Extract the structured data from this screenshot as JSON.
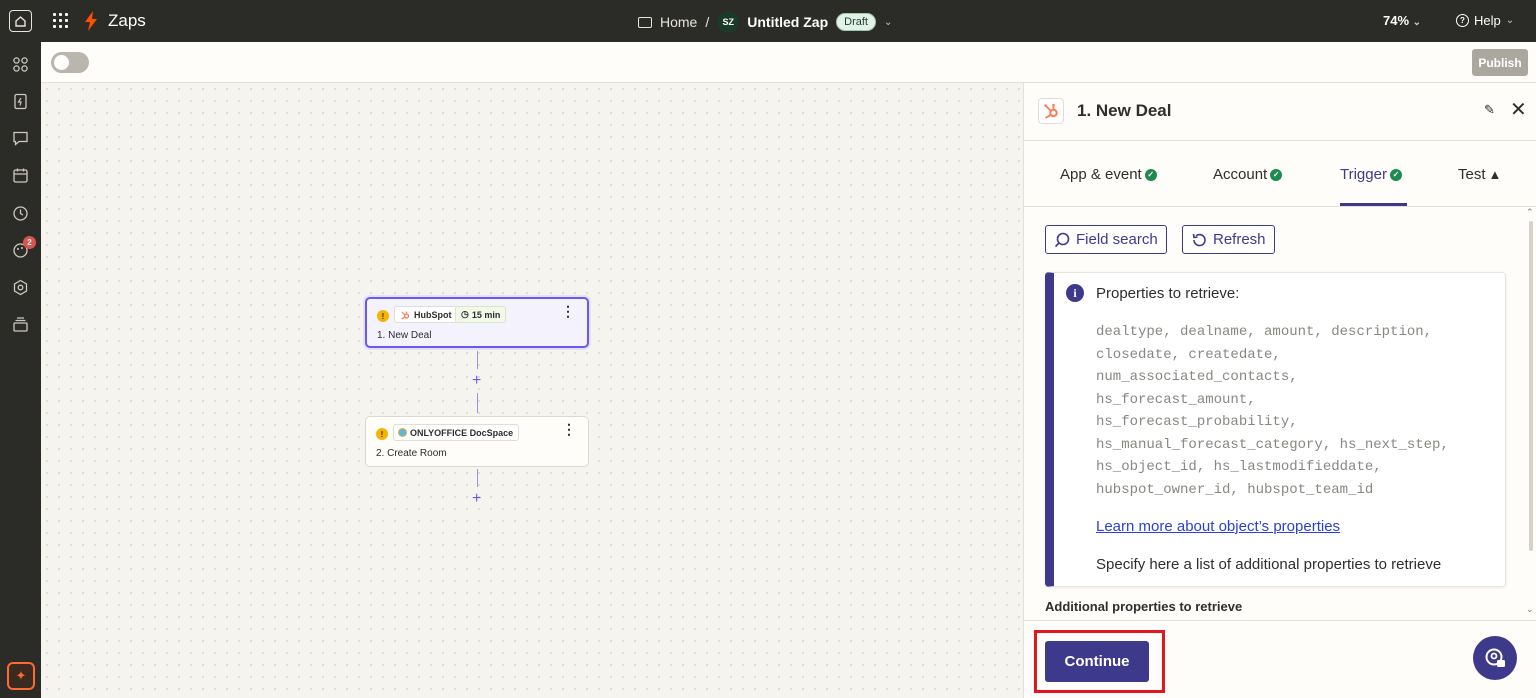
{
  "topbar": {
    "app_name": "Zaps",
    "breadcrumb_home": "Home",
    "breadcrumb_sep": "/",
    "user_initials": "SZ",
    "zap_name": "Untitled Zap",
    "status_badge": "Draft",
    "zoom_level": "74%",
    "help_label": "Help"
  },
  "toolbar": {
    "publish_label": "Publish",
    "zap_enabled": false
  },
  "leftnav": {
    "items": [
      "apps-icon",
      "zaps-icon",
      "interfaces-icon",
      "tables-icon",
      "history-icon",
      "canvas-icon",
      "settings-icon",
      "archive-icon"
    ],
    "notification_count": "2"
  },
  "canvas": {
    "steps": [
      {
        "app": "HubSpot",
        "time": "15 min",
        "title": "1. New Deal"
      },
      {
        "app": "ONLYOFFICE DocSpace",
        "title": "2. Create Room"
      }
    ],
    "plus": "+"
  },
  "panel": {
    "title": "1. New Deal",
    "tabs": [
      {
        "label": "App & event",
        "status": "complete"
      },
      {
        "label": "Account",
        "status": "complete"
      },
      {
        "label": "Trigger",
        "status": "complete",
        "active": true
      },
      {
        "label": "Test",
        "status": "warning"
      }
    ],
    "field_search_label": "Field search",
    "refresh_label": "Refresh",
    "info": {
      "title": "Properties to retrieve:",
      "properties": "dealtype, dealname, amount, description,\nclosedate, createdate,\nnum_associated_contacts,\nhs_forecast_amount,\nhs_forecast_probability,\nhs_manual_forecast_category, hs_next_step,\nhs_object_id, hs_lastmodifieddate,\nhubspot_owner_id, hubspot_team_id",
      "link": "Learn more about object’s properties",
      "description": "Specify here a list of additional properties to retrieve"
    },
    "additional_label": "Additional properties to retrieve",
    "continue_label": "Continue"
  },
  "colors": {
    "accent": "#3d3a8c",
    "brand_orange": "#ff4f00",
    "highlight_red": "#e3161f",
    "success": "#1d8a4e"
  }
}
